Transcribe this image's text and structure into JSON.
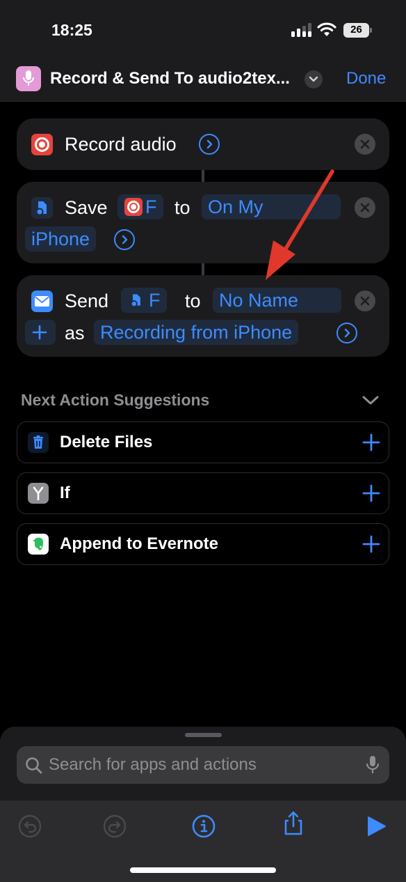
{
  "status": {
    "time": "18:25",
    "battery": "26"
  },
  "nav": {
    "title": "Record & Send To audio2tex...",
    "done_label": "Done"
  },
  "actions": {
    "record": {
      "label": "Record audio"
    },
    "save": {
      "verb": "Save",
      "var_label": "F",
      "to": "to",
      "destination_line1": "On My",
      "destination_line2": "iPhone"
    },
    "send": {
      "verb": "Send",
      "var_label": "F",
      "to": "to",
      "recipient": "No Name",
      "as": "as",
      "subject": "Recording from iPhone"
    }
  },
  "suggestions": {
    "header": "Next Action Suggestions",
    "items": [
      {
        "label": "Delete Files",
        "icon": "trash-icon"
      },
      {
        "label": "If",
        "icon": "branch-icon"
      },
      {
        "label": "Append to Evernote",
        "icon": "evernote-icon"
      }
    ]
  },
  "search": {
    "placeholder": "Search for apps and actions"
  },
  "colors": {
    "accent": "#3e8bff",
    "record_red": "#e5443d",
    "annotation_arrow": "#e0382a",
    "app_icon_pink": "#e49ad6"
  }
}
